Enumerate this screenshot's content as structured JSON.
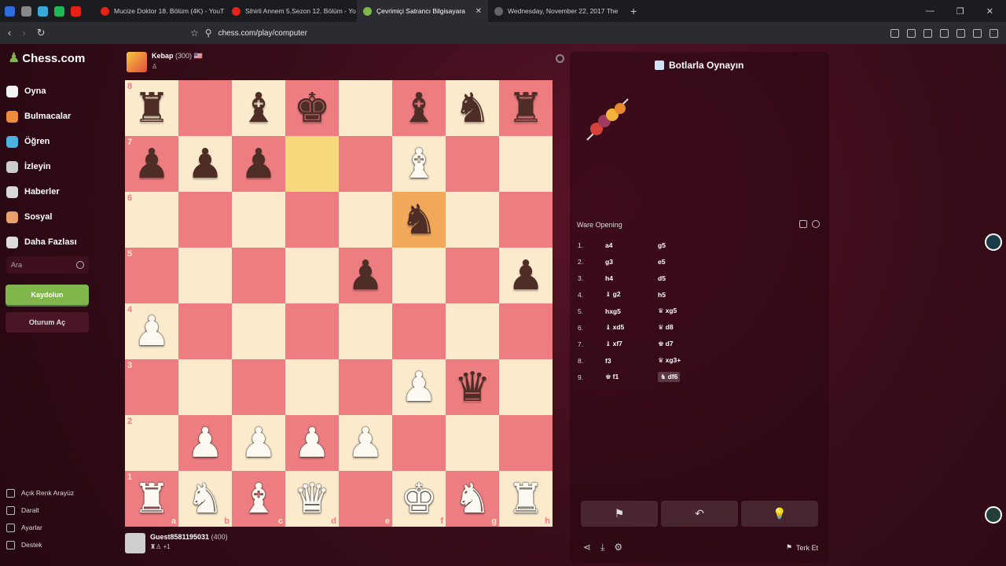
{
  "browser": {
    "tabs": [
      {
        "title": "Mucize Doktor 18. Bölüm (4K) - YouT",
        "favicon_color": "#e62117",
        "active": false
      },
      {
        "title": "Sihirli Annem 5.Sezon 12. Bölüm - Yo",
        "favicon_color": "#e62117",
        "active": false
      },
      {
        "title": "Çevrimiçi Satrancı Bilgisayara",
        "favicon_color": "#81b64c",
        "active": true
      },
      {
        "title": "Wednesday, November 22, 2017 The",
        "favicon_color": "#666666",
        "active": false
      }
    ],
    "url": "chess.com/play/computer"
  },
  "sidebar": {
    "logo": "Chess.com",
    "items": [
      {
        "label": "Oyna",
        "icon": "pawn-play-icon",
        "color": "#f3f3f3"
      },
      {
        "label": "Bulmacalar",
        "icon": "puzzle-icon",
        "color": "#f08b3c"
      },
      {
        "label": "Öğren",
        "icon": "learn-icon",
        "color": "#4bb3e0"
      },
      {
        "label": "İzleyin",
        "icon": "binoculars-icon",
        "color": "#cccccc"
      },
      {
        "label": "Haberler",
        "icon": "news-icon",
        "color": "#d9d9d9"
      },
      {
        "label": "Sosyal",
        "icon": "social-icon",
        "color": "#e9a06a"
      },
      {
        "label": "Daha Fazlası",
        "icon": "more-icon",
        "color": "#dddddd"
      }
    ],
    "search_placeholder": "Ara",
    "signup": "Kaydolun",
    "login": "Oturum Aç",
    "bottom": [
      "Açık Renk Arayüz",
      "Daralt",
      "Ayarlar",
      "Destek"
    ]
  },
  "opponent": {
    "name": "Kebap",
    "rating": "(300)",
    "flag": "🇺🇸"
  },
  "player": {
    "name": "Guest8581195031",
    "rating": "(400)",
    "extra": "+1"
  },
  "board": {
    "ranks": [
      "8",
      "7",
      "6",
      "5",
      "4",
      "3",
      "2",
      "1"
    ],
    "files": [
      "a",
      "b",
      "c",
      "d",
      "e",
      "f",
      "g",
      "h"
    ],
    "position": [
      [
        "bR",
        "",
        "bB",
        "bK",
        "",
        "bB",
        "bN",
        "bR"
      ],
      [
        "bP",
        "bP",
        "bP",
        "",
        "",
        "wB",
        "",
        ""
      ],
      [
        "",
        "",
        "",
        "",
        "",
        "bN",
        "",
        ""
      ],
      [
        "",
        "",
        "",
        "",
        "bP",
        "",
        "",
        "bP"
      ],
      [
        "wP",
        "",
        "",
        "",
        "",
        "",
        "",
        ""
      ],
      [
        "",
        "",
        "",
        "",
        "",
        "wP",
        "bQ",
        ""
      ],
      [
        "",
        "wP",
        "wP",
        "wP",
        "wP",
        "",
        "",
        ""
      ],
      [
        "wR",
        "wN",
        "wB",
        "wQ",
        "",
        "wK",
        "wN",
        "wR"
      ]
    ],
    "highlight_light": [
      "d7"
    ],
    "highlight_orange": [
      "f6"
    ]
  },
  "panel": {
    "title": "Botlarla Oynayın",
    "opening": "Ware Opening",
    "moves": [
      {
        "no": "1.",
        "white": "a4",
        "black": "g5"
      },
      {
        "no": "2.",
        "white": "g3",
        "black": "e5"
      },
      {
        "no": "3.",
        "white": "h4",
        "black": "d5"
      },
      {
        "no": "4.",
        "white": "g2",
        "wpiece": "♝",
        "black": "h5"
      },
      {
        "no": "5.",
        "white": "hxg5",
        "black": "xg5",
        "bpiece": "♛"
      },
      {
        "no": "6.",
        "white": "xd5",
        "wpiece": "♝",
        "black": "d8",
        "bpiece": "♛"
      },
      {
        "no": "7.",
        "white": "xf7",
        "wpiece": "♝",
        "black": "d7",
        "bpiece": "♚"
      },
      {
        "no": "8.",
        "white": "f3",
        "black": "xg3+",
        "bpiece": "♛"
      },
      {
        "no": "9.",
        "white": "f1",
        "wpiece": "♚",
        "black": "df6",
        "bpiece": "♞"
      }
    ],
    "resign": "Terk Et"
  }
}
